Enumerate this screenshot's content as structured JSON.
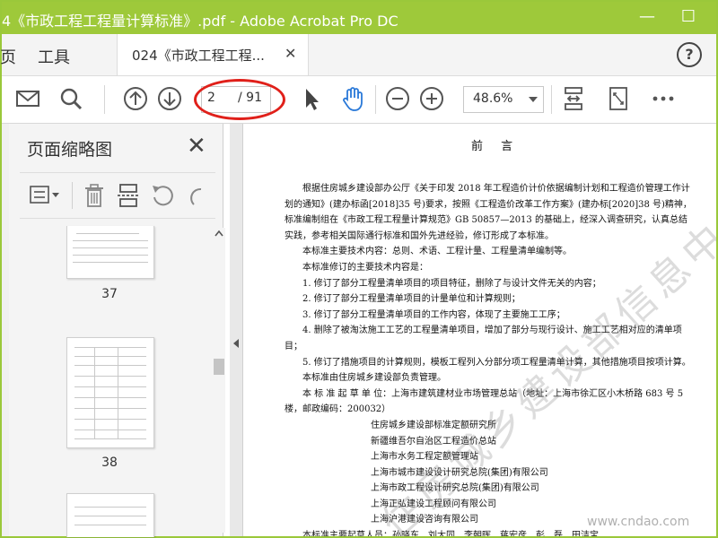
{
  "window": {
    "title": "4《市政工程工程量计算标准》.pdf - Adobe Acrobat Pro DC",
    "minimize": "—",
    "maximize": "☐"
  },
  "nav": {
    "home_partial": "页",
    "tools": "工具"
  },
  "tab": {
    "label": "024《市政工程工程...",
    "close": "✕"
  },
  "help": "?",
  "toolbar": {
    "page_current": "2",
    "page_total": "/ 91",
    "zoom": "48.6%"
  },
  "panel": {
    "title": "页面缩略图",
    "close": "✕"
  },
  "thumbnails": [
    {
      "label": "37"
    },
    {
      "label": "38"
    }
  ],
  "document": {
    "heading": "前  言",
    "paragraphs": [
      "根据住房城乡建设部办公厅《关于印发 2018 年工程造价计价依据编制计划和工程造价管理工作计划的通知》(建办标函[2018]35 号)要求，按照《工程造价改革工作方案》(建办标[2020]38 号)精神，标准编制组在《市政工程工程量计算规范》GB 50857—2013 的基础上，经深入调查研究，认真总结实践，参考相关国际通行标准和国外先进经验，修订形成了本标准。",
      "本标准主要技术内容：总则、术语、工程计量、工程量清单编制等。",
      "本标准修订的主要技术内容是：",
      "1. 修订了部分工程量清单项目的项目特征，删除了与设计文件无关的内容；",
      "2. 修订了部分工程量清单项目的计量单位和计算规则；",
      "3. 修订了部分工程量清单项目的工作内容，体现了主要施工工序；",
      "4. 删除了被淘汰施工工艺的工程量清单项目，增加了部分与现行设计、施工工艺相对应的清单项目；",
      "5. 修订了措施项目的计算规则，模板工程列入分部分项工程量清单计算，其他措施项目按项计算。",
      "本标准由住房城乡建设部负责管理。",
      "本 标 准 起 草 单 位：上海市建筑建材业市场管理总站（地址：上海市徐汇区小木桥路 683 号 5 楼，邮政编码：200032）"
    ],
    "orgs": [
      "住房城乡建设部标准定额研究所",
      "新疆维吾尔自治区工程造价总站",
      "上海市水务工程定额管理站",
      "上海市城市建设设计研究总院(集团)有限公司",
      "上海市政工程设计研究总院(集团)有限公司",
      "上海正弘建设工程顾问有限公司",
      "上海沪港建设咨询有限公司"
    ],
    "last_line": "本标准主要起草人员：孙晓东　刘大同　李朝晖　蒋宏彦　彭　磊　田洁宝",
    "watermark": "住房城乡建设部信息中心 浏览专用",
    "site_mark": "www.cndao.com"
  },
  "colors": {
    "titlebar": "#9ec93a",
    "hand_tool": "#2a79d8",
    "annotation_ellipse": "#e0201a"
  }
}
